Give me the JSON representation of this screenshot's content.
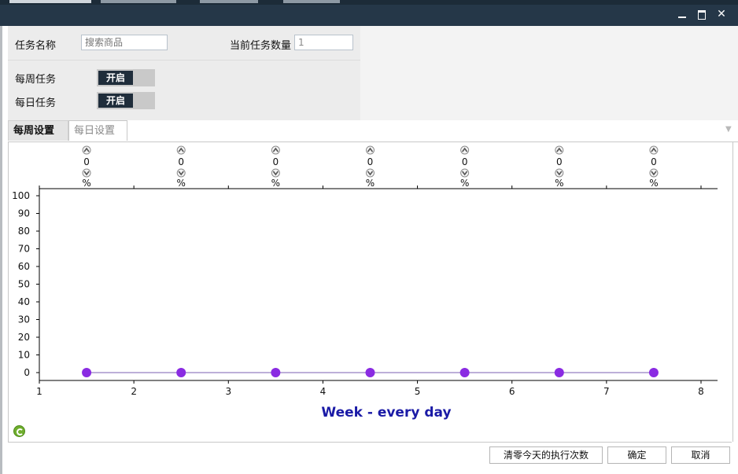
{
  "window": {
    "controls": [
      "minimize",
      "maximize",
      "close"
    ]
  },
  "form": {
    "task_name_label": "任务名称",
    "task_name_placeholder": "搜索商品",
    "current_count_label": "当前任务数量",
    "current_count_value": "1",
    "weekly_label": "每周任务",
    "weekly_toggle": "开启",
    "daily_label": "每日任务",
    "daily_toggle": "开启"
  },
  "tabs": [
    {
      "label": "每周设置",
      "active": true
    },
    {
      "label": "每日设置",
      "active": false
    }
  ],
  "chart_data": {
    "type": "line",
    "xlabel": "Week - every day",
    "ylabel": "",
    "xlim": [
      1,
      8
    ],
    "ylim": [
      0,
      100
    ],
    "x_ticks": [
      1,
      2,
      3,
      4,
      5,
      6,
      7,
      8
    ],
    "y_ticks": [
      0,
      10,
      20,
      30,
      40,
      50,
      60,
      70,
      80,
      90,
      100
    ],
    "x": [
      1.5,
      2.5,
      3.5,
      4.5,
      5.5,
      6.5,
      7.5
    ],
    "values": [
      0,
      0,
      0,
      0,
      0,
      0,
      0
    ],
    "value_unit": "%",
    "point_color": "#8a2be2",
    "line_color": "#7b5fb0",
    "xlabel_color": "#1a1aa6",
    "grid": false
  },
  "footer": {
    "reset_button": "清零今天的执行次数",
    "ok_button": "确定",
    "cancel_button": "取消"
  }
}
